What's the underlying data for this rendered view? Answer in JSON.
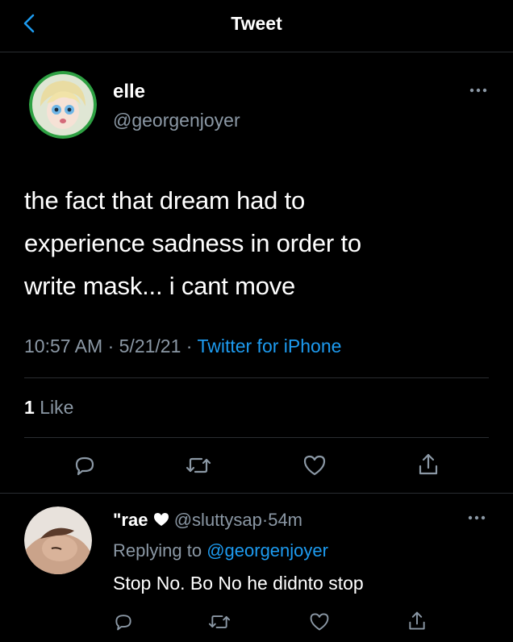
{
  "header": {
    "title": "Tweet"
  },
  "tweet": {
    "author_name": "elle",
    "author_handle": "@georgenjoyer",
    "text_lines": [
      "the fact that dream had to",
      "experience sadness in order to",
      "write mask... i cant move"
    ],
    "time": "10:57 AM",
    "date": "5/21/21",
    "sep": "·",
    "source": "Twitter for iPhone",
    "like_count": "1",
    "like_label": "Like"
  },
  "reply": {
    "name": "\"rae",
    "handle": "@sluttysap",
    "sep": "·",
    "age": "54m",
    "replying_prefix": "Replying to",
    "replying_to": "@georgenjoyer",
    "text": "Stop No. Bo No he didnto stop"
  },
  "icons": [
    "chevron-left-icon",
    "more-icon",
    "reply-icon",
    "retweet-icon",
    "like-icon",
    "share-icon",
    "heart-icon"
  ],
  "colors": {
    "background": "#000000",
    "accent": "#1d9bf0",
    "secondary_text": "#8b98a5",
    "divider": "#2a2d31",
    "avatar_ring": "#2ea043"
  }
}
